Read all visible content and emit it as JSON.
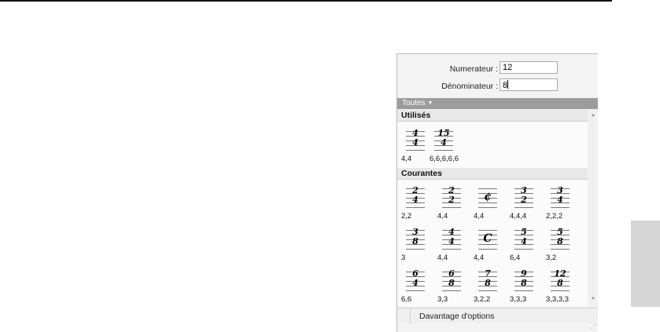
{
  "form": {
    "numerator_label": "Numerateur :",
    "numerator_value": "12",
    "denominator_label": "Dénominateur :",
    "denominator_value": "8"
  },
  "filter": {
    "label": "Toutes"
  },
  "sections": {
    "used": {
      "title": "Utilisés",
      "items": [
        {
          "top": "4",
          "bottom": "4",
          "caption": "4,4"
        },
        {
          "top": "15",
          "bottom": "4",
          "caption": "6,6,6,6,6"
        }
      ]
    },
    "common": {
      "title": "Courantes",
      "items": [
        {
          "top": "2",
          "bottom": "4",
          "caption": "2,2"
        },
        {
          "top": "2",
          "bottom": "2",
          "caption": "4,4"
        },
        {
          "symbol": "¢",
          "caption": "4,4"
        },
        {
          "top": "3",
          "bottom": "2",
          "caption": "4,4,4"
        },
        {
          "top": "3",
          "bottom": "4",
          "caption": "2,2,2"
        },
        {
          "top": "3",
          "bottom": "8",
          "caption": "3"
        },
        {
          "top": "4",
          "bottom": "4",
          "caption": "4,4"
        },
        {
          "symbol": "C",
          "caption": "4,4"
        },
        {
          "top": "5",
          "bottom": "4",
          "caption": "6,4"
        },
        {
          "top": "5",
          "bottom": "8",
          "caption": "3,2"
        },
        {
          "top": "6",
          "bottom": "4",
          "caption": "6,6"
        },
        {
          "top": "6",
          "bottom": "8",
          "caption": "3,3"
        },
        {
          "top": "7",
          "bottom": "8",
          "caption": "3,2,2"
        },
        {
          "top": "9",
          "bottom": "8",
          "caption": "3,3,3"
        },
        {
          "top": "12",
          "bottom": "8",
          "caption": "3,3,3,3"
        }
      ]
    }
  },
  "footer": {
    "more_options_label": "Davantage d'options"
  },
  "icons": {
    "dropdown": "triangle-down",
    "scroll_up": "arrow-up",
    "scroll_down": "arrow-down",
    "resize": "resize-grip"
  }
}
